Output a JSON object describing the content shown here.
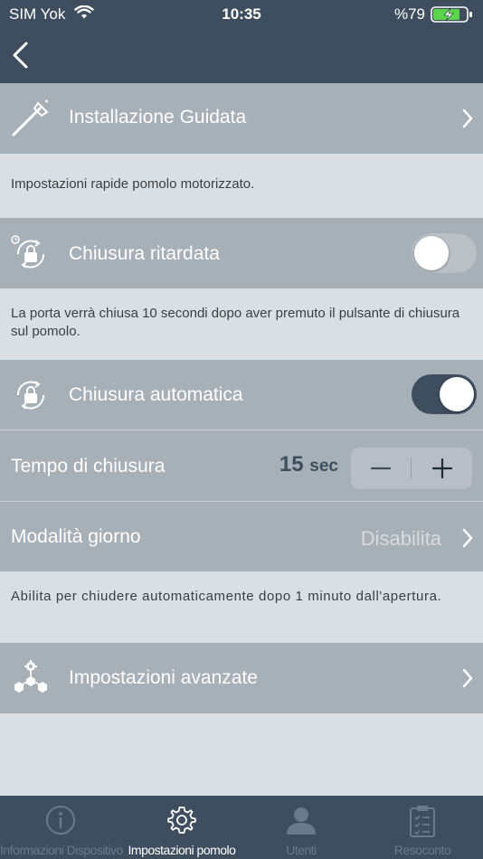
{
  "status_bar": {
    "carrier": "SIM Yok",
    "time": "10:35",
    "battery_percent": "%79"
  },
  "header": {
    "back_icon": "chevron-left-icon"
  },
  "guided_setup": {
    "title": "Installazione Guidata",
    "icon": "wand-icon",
    "description": "Impostazioni rapide pomolo motorizzato."
  },
  "delayed_lock": {
    "title": "Chiusura ritardata",
    "icon": "timer-lock-icon",
    "enabled": false,
    "description": "La porta verrà chiusa 10 secondi dopo aver premuto il pulsante di chiusura sul pomolo."
  },
  "auto_lock": {
    "title": "Chiusura automatica",
    "icon": "auto-lock-icon",
    "enabled": true
  },
  "lock_time": {
    "label": "Tempo di chiusura",
    "value": "15",
    "unit": "sec",
    "minus_symbol": "−",
    "plus_symbol": "+"
  },
  "day_mode": {
    "label": "Modalità giorno",
    "value": "Disabilita",
    "description": "Abilita per chiudere automaticamente dopo 1 minuto dall'apertura."
  },
  "advanced": {
    "title": "Impostazioni avanzate",
    "icon": "network-gear-icon"
  },
  "tab_bar": {
    "tabs": [
      {
        "label": "Informazioni Dispositivo",
        "icon": "info-icon",
        "active": false
      },
      {
        "label": "Impostazioni pomolo",
        "icon": "gear-icon",
        "active": true
      },
      {
        "label": "Utenti",
        "icon": "user-icon",
        "active": false
      },
      {
        "label": "Resoconto",
        "icon": "clipboard-icon",
        "active": false
      }
    ]
  },
  "colors": {
    "header": "#3e4e5f",
    "row": "#a7afb7",
    "background": "#dadfe3",
    "accent": "#3e4e5f"
  }
}
